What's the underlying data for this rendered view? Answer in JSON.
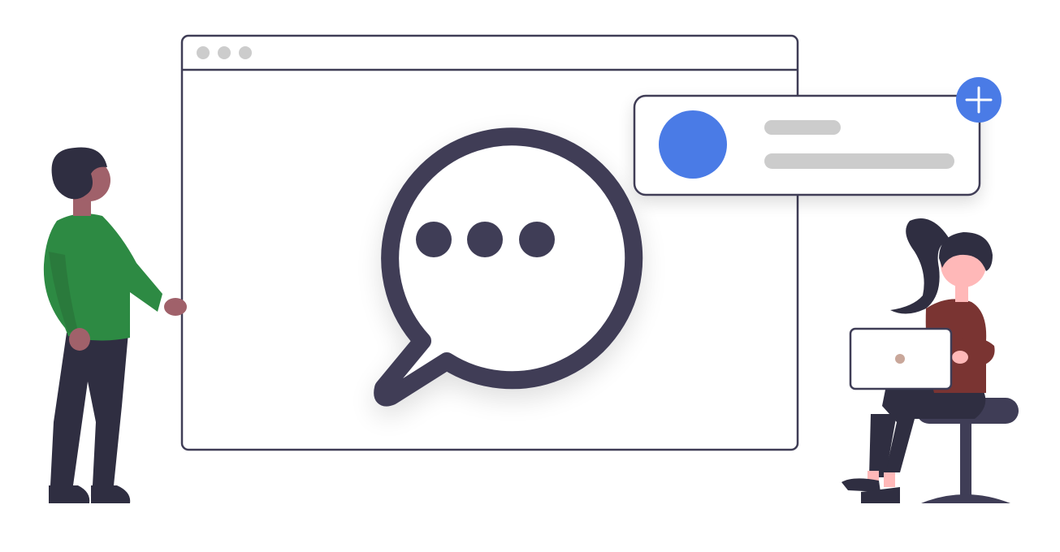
{
  "colors": {
    "outline": "#3f3d56",
    "accent_blue": "#4a7be6",
    "window_dot": "#cccccc",
    "placeholder_bar": "#cccccc",
    "shirt_green": "#2d8a43",
    "skin_dark": "#a0616a",
    "shirt_maroon": "#7a3432",
    "skin_light": "#ffb8b8",
    "pants_dark": "#2f2e41"
  },
  "icons": {
    "chat": "chat-bubble-icon",
    "add": "plus-icon",
    "avatar": "avatar-circle"
  }
}
